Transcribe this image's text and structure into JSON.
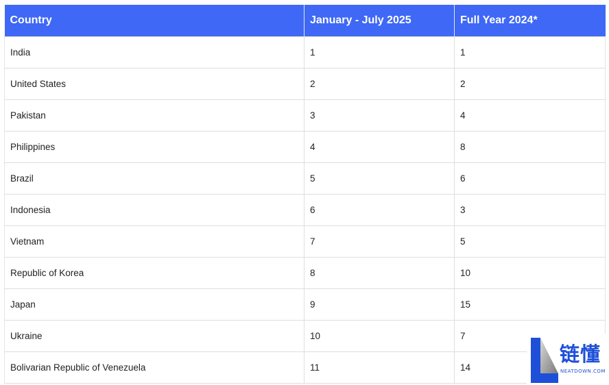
{
  "table": {
    "headers": [
      "Country",
      "January - July 2025",
      "Full Year 2024*"
    ],
    "rows": [
      [
        "India",
        "1",
        "1"
      ],
      [
        "United States",
        "2",
        "2"
      ],
      [
        "Pakistan",
        "3",
        "4"
      ],
      [
        "Philippines",
        "4",
        "8"
      ],
      [
        "Brazil",
        "5",
        "6"
      ],
      [
        "Indonesia",
        "6",
        "3"
      ],
      [
        "Vietnam",
        "7",
        "5"
      ],
      [
        "Republic of Korea",
        "8",
        "10"
      ],
      [
        "Japan",
        "9",
        "15"
      ],
      [
        "Ukraine",
        "10",
        "7"
      ],
      [
        "Bolivarian Republic of Venezuela",
        "11",
        "14"
      ]
    ]
  },
  "colors": {
    "header_bg": "#3e68f5",
    "header_text": "#ffffff",
    "grid": "#dedede",
    "watermark": "#1e4fd8"
  },
  "watermark": {
    "title": "链懂",
    "subtitle": "NEATDOWN.COM",
    "logo_icon": "letter-l-logo-icon"
  }
}
